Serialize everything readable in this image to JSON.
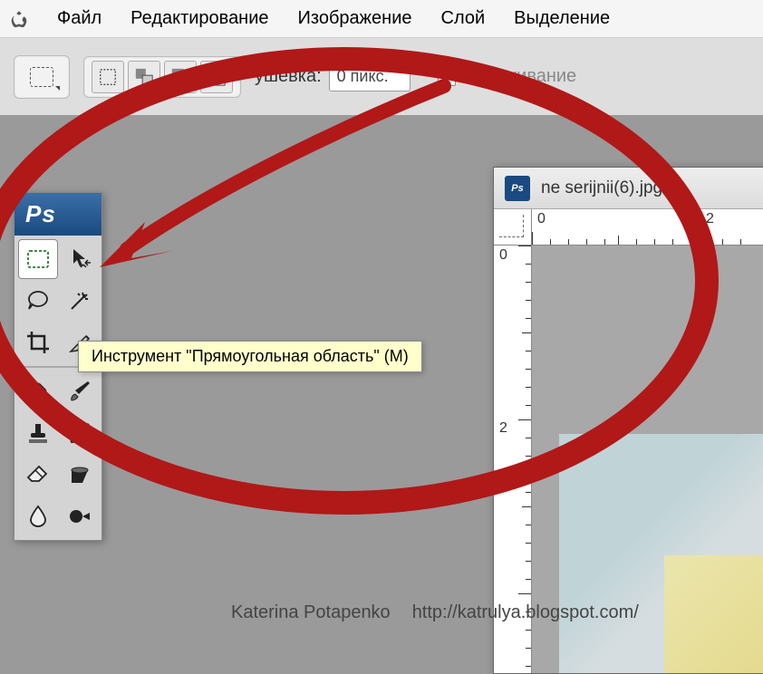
{
  "menu": {
    "file": "Файл",
    "edit": "Редактирование",
    "image": "Изображение",
    "layer": "Слой",
    "select": "Выделение"
  },
  "options": {
    "feather_label": "ушёвка:",
    "feather_value": "0 пикс.",
    "antialias_label": "Сглаживание"
  },
  "tools_panel": {
    "logo": "Ps"
  },
  "tooltip": "Инструмент \"Прямоугольная область\" (M)",
  "document": {
    "title": "ne serijnii(6).jpg",
    "ruler_marks": {
      "h0": "0",
      "h2": "2",
      "v0": "0",
      "v2": "2"
    }
  },
  "watermark": {
    "author": "Katerina Potapenko",
    "url": "http://katrulya.blogspot.com/"
  }
}
